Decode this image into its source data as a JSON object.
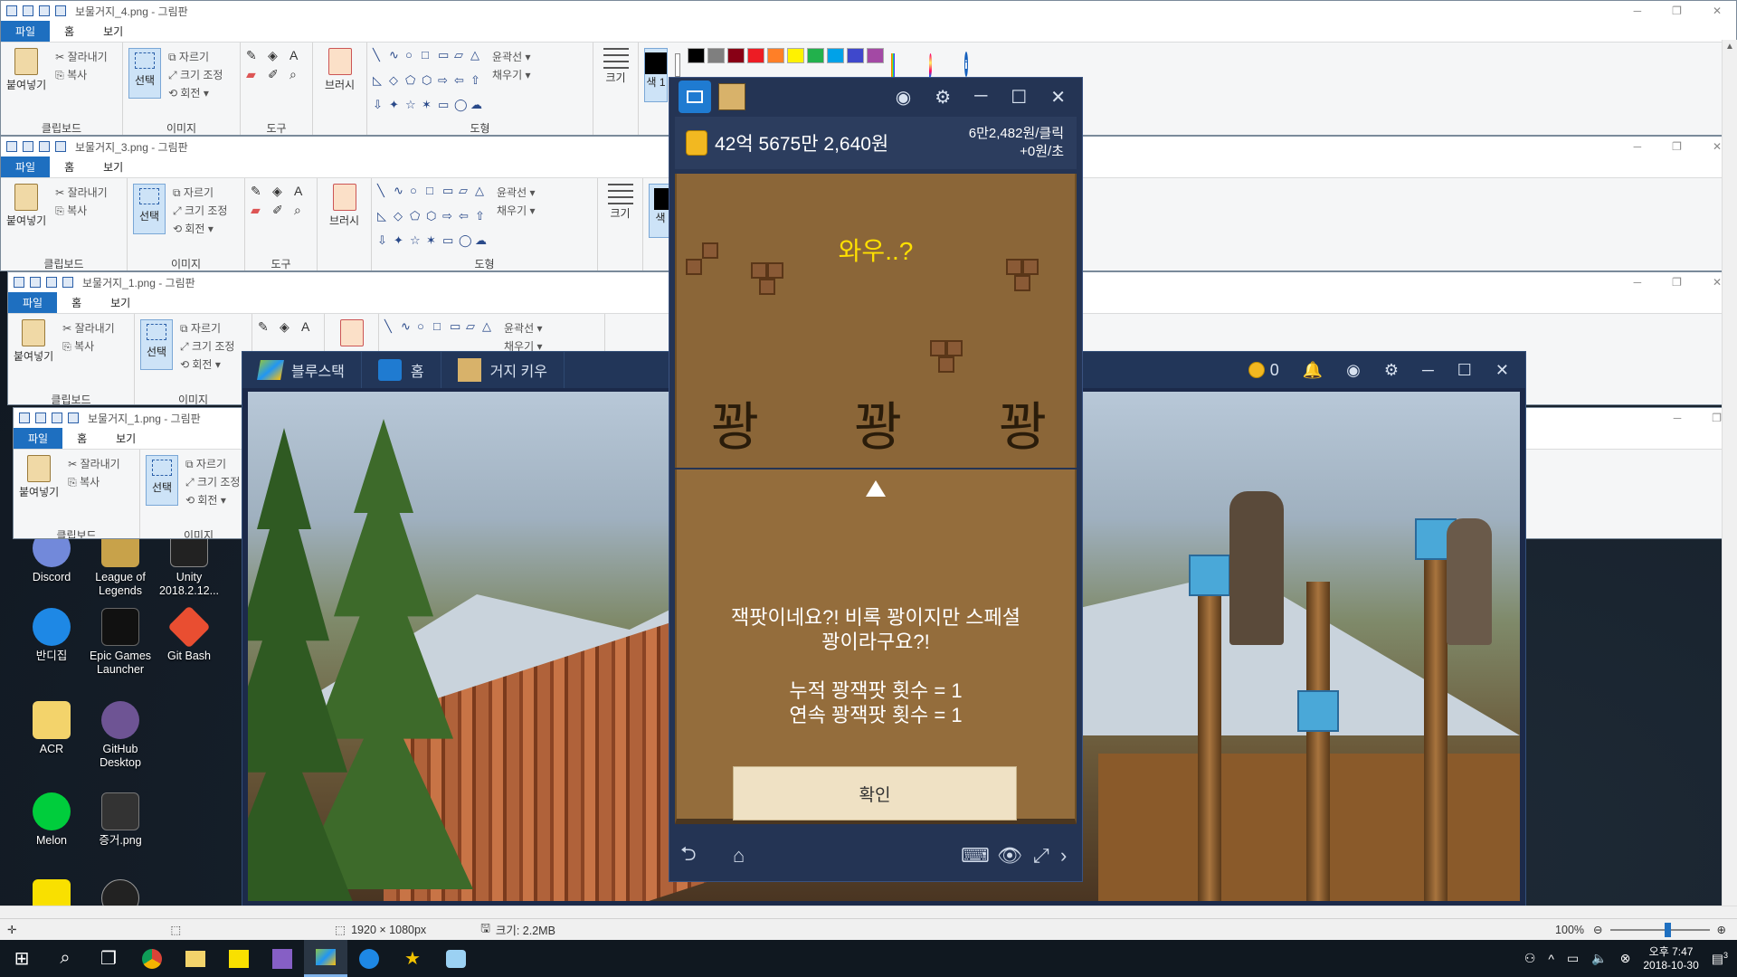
{
  "paint_windows": [
    {
      "title": "보물거지_4.png - 그림판",
      "tabs": [
        "파일",
        "홈",
        "보기"
      ],
      "clipboard": {
        "paste": "붙여넣기",
        "cut": "잘라내기",
        "copy": "복사",
        "label": "클립보드"
      },
      "image": {
        "select": "선택",
        "crop": "자르기",
        "resize": "크기 조정",
        "rotate": "회전",
        "label": "이미지"
      },
      "tools_label": "도구",
      "brush": "브러시",
      "shapes_label": "도형",
      "outline": "윤곽선",
      "fill": "채우기",
      "size": "크기",
      "color1": "색\n1"
    },
    {
      "title": "보물거지_3.png - 그림판",
      "tabs": [
        "파일",
        "홈",
        "보기"
      ],
      "clipboard": {
        "paste": "붙여넣기",
        "cut": "잘라내기",
        "copy": "복사",
        "label": "클립보드"
      },
      "image": {
        "select": "선택",
        "crop": "자르기",
        "resize": "크기 조정",
        "rotate": "회전",
        "label": "이미지"
      },
      "tools_label": "도구",
      "brush": "브러시",
      "shapes_label": "도형",
      "outline": "윤곽선",
      "fill": "채우기",
      "size": "크기",
      "color1": "색\n1"
    },
    {
      "title": "보물거지_1.png - 그림판",
      "tabs": [
        "파일",
        "홈",
        "보기"
      ],
      "clipboard": {
        "paste": "붙여넣기",
        "cut": "잘라내기",
        "copy": "복사",
        "label": "클립보드"
      },
      "image": {
        "select": "선택",
        "crop": "자르기",
        "resize": "크기 조정",
        "rotate": "회전",
        "label": "이미지"
      },
      "outline": "윤곽선",
      "fill": "채우기"
    },
    {
      "title": "보물거지_1.png - 그림판",
      "tabs": [
        "파일",
        "홈",
        "보기"
      ],
      "clipboard": {
        "paste": "붙여넣기",
        "cut": "잘라내기",
        "copy": "복사",
        "label": "클립보드"
      },
      "image": {
        "select": "선택",
        "crop": "자르기",
        "resize": "크기 조정",
        "rotate": "회전",
        "label": "이미지"
      }
    }
  ],
  "bluestacks": {
    "tab_app": "블루스택",
    "tab_home": "홈",
    "tab_game": "거지 키우",
    "coins": "0"
  },
  "game": {
    "money": "42억 5675만 2,640원",
    "per_click": "6만2,482원/클릭",
    "per_sec": "+0원/초",
    "headline": "와우..?",
    "kwang": [
      "꽝",
      "꽝",
      "꽝"
    ],
    "message_line1": "잭팟이네요?! 비록 꽝이지만 스페셜",
    "message_line2": "꽝이라구요?!",
    "stat1": "누적 꽝잭팟 횟수 = 1",
    "stat2": "연속 꽝잭팟 횟수 = 1",
    "ok": "확인"
  },
  "desktop_icons": [
    {
      "label": "Discord",
      "color": "#7289da"
    },
    {
      "label": "League of Legends",
      "color": "#c8a24a"
    },
    {
      "label": "Unity 2018.2.12...",
      "color": "#222222"
    },
    {
      "label": "반디집",
      "color": "#1e88e5"
    },
    {
      "label": "Epic Games Launcher",
      "color": "#111111"
    },
    {
      "label": "Git Bash",
      "color": "#e94e31"
    },
    {
      "label": "ACR",
      "color": "#f3d36b"
    },
    {
      "label": "GitHub Desktop",
      "color": "#6e5494"
    },
    {
      "label": "Melon",
      "color": "#00cd3c"
    },
    {
      "label": "증거.png",
      "color": "#333333"
    }
  ],
  "statusbar": {
    "dimensions": "1920 × 1080px",
    "size": "크기: 2.2MB",
    "zoom": "100%"
  },
  "taskbar": {
    "time": "오후 7:47",
    "date": "2018-10-30",
    "notif": "3"
  },
  "palette": [
    "#000000",
    "#7f7f7f",
    "#880015",
    "#ed1c24",
    "#ff7f27",
    "#fff200",
    "#22b14c",
    "#00a2e8",
    "#3f48cc",
    "#a349a4"
  ]
}
